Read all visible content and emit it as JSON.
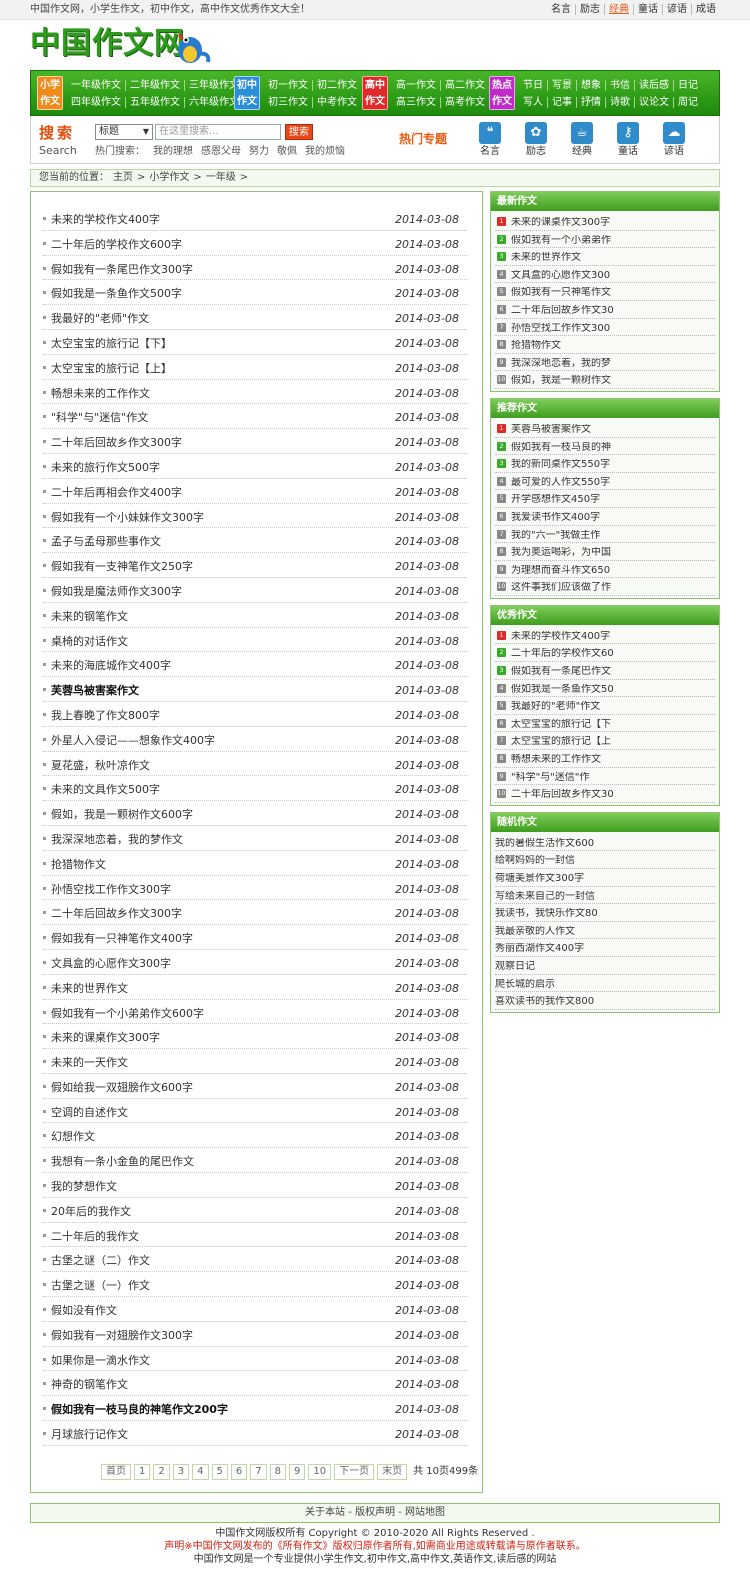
{
  "topbar": {
    "slogan": "中国作文网，小学生作文，初中作文，高中作文优秀作文大全！",
    "links": [
      "名言",
      "励志",
      "经典",
      "童话",
      "谚语",
      "成语"
    ],
    "active_link": "经典"
  },
  "logo": {
    "text": "中国作文网"
  },
  "nav": {
    "groups": [
      {
        "label1": "小学",
        "label2": "作文",
        "color": "#f08a1a",
        "row1": [
          "一年级作文",
          "二年级作文",
          "三年级作文"
        ],
        "row2": [
          "四年级作文",
          "五年级作文",
          "六年级作文"
        ]
      },
      {
        "label1": "初中",
        "label2": "作文",
        "color": "#2a8ed8",
        "row1": [
          "初一作文",
          "初二作文"
        ],
        "row2": [
          "初三作文",
          "中考作文"
        ]
      },
      {
        "label1": "高中",
        "label2": "作文",
        "color": "#e02a2a",
        "row1": [
          "高一作文",
          "高二作文"
        ],
        "row2": [
          "高三作文",
          "高考作文"
        ]
      },
      {
        "label1": "热点",
        "label2": "作文",
        "color": "#c02ac8",
        "row1": [
          "节日",
          "写景",
          "想象",
          "书信",
          "读后感",
          "日记"
        ],
        "row2": [
          "写人",
          "记事",
          "抒情",
          "诗歌",
          "议论文",
          "周记"
        ]
      }
    ]
  },
  "search": {
    "label": "搜索",
    "label_en": "Search",
    "select_value": "标题",
    "placeholder": "在这里搜索...",
    "button": "搜索",
    "hot_label": "热门搜索：",
    "hot": [
      "我的理想",
      "感恩父母",
      "努力",
      "敬佩",
      "我的烦恼"
    ],
    "topic": "热门专题",
    "icons": [
      {
        "label": "名言",
        "icon": "quote-icon"
      },
      {
        "label": "励志",
        "icon": "flower-icon"
      },
      {
        "label": "经典",
        "icon": "teapot-icon"
      },
      {
        "label": "童话",
        "icon": "key-icon"
      },
      {
        "label": "谚语",
        "icon": "cloud-icon"
      }
    ]
  },
  "breadcrumb": [
    "您当前的位置：",
    "主页",
    ">",
    "小学作文",
    ">",
    "一年级",
    ">"
  ],
  "articles": [
    {
      "title": "未来的学校作文400字",
      "date": "2014-03-08"
    },
    {
      "title": "二十年后的学校作文600字",
      "date": "2014-03-08"
    },
    {
      "title": "假如我有一条尾巴作文300字",
      "date": "2014-03-08"
    },
    {
      "title": "假如我是一条鱼作文500字",
      "date": "2014-03-08"
    },
    {
      "title": "我最好的\"老师\"作文",
      "date": "2014-03-08"
    },
    {
      "title": "太空宝宝的旅行记【下】",
      "date": "2014-03-08"
    },
    {
      "title": "太空宝宝的旅行记【上】",
      "date": "2014-03-08"
    },
    {
      "title": "畅想未来的工作作文",
      "date": "2014-03-08"
    },
    {
      "title": "\"科学\"与\"迷信\"作文",
      "date": "2014-03-08"
    },
    {
      "title": "二十年后回故乡作文300字",
      "date": "2014-03-08"
    },
    {
      "title": "未来的旅行作文500字",
      "date": "2014-03-08"
    },
    {
      "title": "二十年后再相会作文400字",
      "date": "2014-03-08"
    },
    {
      "title": "假如我有一个小妹妹作文300字",
      "date": "2014-03-08"
    },
    {
      "title": "孟子与孟母那些事作文",
      "date": "2014-03-08"
    },
    {
      "title": "假如我有一支神笔作文250字",
      "date": "2014-03-08"
    },
    {
      "title": "假如我是魔法师作文300字",
      "date": "2014-03-08"
    },
    {
      "title": "未来的钢笔作文",
      "date": "2014-03-08"
    },
    {
      "title": "桌椅的对话作文",
      "date": "2014-03-08"
    },
    {
      "title": "未来的海底城作文400字",
      "date": "2014-03-08"
    },
    {
      "title": "芙蓉鸟被害案作文",
      "date": "2014-03-08",
      "bold": true
    },
    {
      "title": "我上春晚了作文800字",
      "date": "2014-03-08"
    },
    {
      "title": "外星人入侵记——想象作文400字",
      "date": "2014-03-08"
    },
    {
      "title": "夏花盛，秋叶凉作文",
      "date": "2014-03-08"
    },
    {
      "title": "未来的文具作文500字",
      "date": "2014-03-08"
    },
    {
      "title": "假如，我是一颗树作文600字",
      "date": "2014-03-08"
    },
    {
      "title": "我深深地恋着，我的梦作文",
      "date": "2014-03-08"
    },
    {
      "title": "抢猎物作文",
      "date": "2014-03-08"
    },
    {
      "title": "孙悟空找工作作文300字",
      "date": "2014-03-08"
    },
    {
      "title": "二十年后回故乡作文300字",
      "date": "2014-03-08"
    },
    {
      "title": "假如我有一只神笔作文400字",
      "date": "2014-03-08"
    },
    {
      "title": "文具盒的心愿作文300字",
      "date": "2014-03-08"
    },
    {
      "title": "未来的世界作文",
      "date": "2014-03-08"
    },
    {
      "title": "假如我有一个小弟弟作文600字",
      "date": "2014-03-08"
    },
    {
      "title": "未来的课桌作文300字",
      "date": "2014-03-08"
    },
    {
      "title": "未来的一天作文",
      "date": "2014-03-08"
    },
    {
      "title": "假如给我一双翅膀作文600字",
      "date": "2014-03-08"
    },
    {
      "title": "空调的自述作文",
      "date": "2014-03-08"
    },
    {
      "title": "幻想作文",
      "date": "2014-03-08"
    },
    {
      "title": "我想有一条小金鱼的尾巴作文",
      "date": "2014-03-08"
    },
    {
      "title": "我的梦想作文",
      "date": "2014-03-08"
    },
    {
      "title": "20年后的我作文",
      "date": "2014-03-08"
    },
    {
      "title": "二十年后的我作文",
      "date": "2014-03-08"
    },
    {
      "title": "古堡之谜（二）作文",
      "date": "2014-03-08"
    },
    {
      "title": "古堡之谜（一）作文",
      "date": "2014-03-08"
    },
    {
      "title": "假如没有作文",
      "date": "2014-03-08"
    },
    {
      "title": "假如我有一对翅膀作文300字",
      "date": "2014-03-08"
    },
    {
      "title": "如果你是一滴水作文",
      "date": "2014-03-08"
    },
    {
      "title": "神奇的钢笔作文",
      "date": "2014-03-08"
    },
    {
      "title": "假如我有一枝马良的神笔作文200字",
      "date": "2014-03-08",
      "bold": true
    },
    {
      "title": "月球旅行记作文",
      "date": "2014-03-08"
    }
  ],
  "pager": {
    "items": [
      "首页",
      "1",
      "2",
      "3",
      "4",
      "5",
      "6",
      "7",
      "8",
      "9",
      "10",
      "下一页",
      "末页"
    ],
    "total": "共 10页499条"
  },
  "sidebar": {
    "latest": {
      "title": "最新作文",
      "items": [
        "未来的课桌作文300字",
        "假如我有一个小弟弟作",
        "未来的世界作文",
        "文具盒的心愿作文300",
        "假如我有一只神笔作文",
        "二十年后回故乡作文30",
        "孙悟空找工作作文300",
        "抢猎物作文",
        "我深深地恋着，我的梦",
        "假如，我是一颗树作文"
      ]
    },
    "recommend": {
      "title": "推荐作文",
      "items": [
        "芙蓉鸟被害案作文",
        "假如我有一枝马良的神",
        "我的新同桌作文550字",
        "最可爱的人作文550字",
        "开学感想作文450字",
        "我爱读书作文400字",
        "我的\"六一\"我做主作",
        "我为奥运喝彩，为中国",
        "为理想而奋斗作文650",
        "这件事我们应该做了作"
      ]
    },
    "excellent": {
      "title": "优秀作文",
      "items": [
        "未来的学校作文400字",
        "二十年后的学校作文60",
        "假如我有一条尾巴作文",
        "假如我是一条鱼作文50",
        "我最好的\"老师\"作文",
        "太空宝宝的旅行记【下",
        "太空宝宝的旅行记【上",
        "畅想未来的工作作文",
        "\"科学\"与\"迷信\"作",
        "二十年后回故乡作文30"
      ]
    },
    "random": {
      "title": "随机作文",
      "items": [
        "我的暑假生活作文600",
        "给啊妈妈的一封信",
        "荷塘美景作文300字",
        "写给未来自己的一封信",
        "我读书，我快乐作文80",
        "我最亲敬的人作文",
        "秀丽西湖作文400字",
        "观察日记",
        "爬长城的启示",
        "喜欢读书的我作文800"
      ]
    },
    "num_colors": [
      "#e02a2a",
      "#3aaa2a",
      "#3aaa2a",
      "#888888",
      "#888888",
      "#888888",
      "#888888",
      "#888888",
      "#888888",
      "#888888"
    ]
  },
  "footer": {
    "links": "关于本站 - 版权声明 - 网站地图",
    "copyright": "中国作文网版权所有 Copyright © 2010-2020 All Rights Reserved .",
    "notice": "声明※中国作文网发布的《所有作文》版权归原作者所有,如需商业用途或转载请与原作者联系。",
    "desc": "中国作文网是一个专业提供小学生作文,初中作文,高中作文,英语作文,读后感的网站"
  }
}
